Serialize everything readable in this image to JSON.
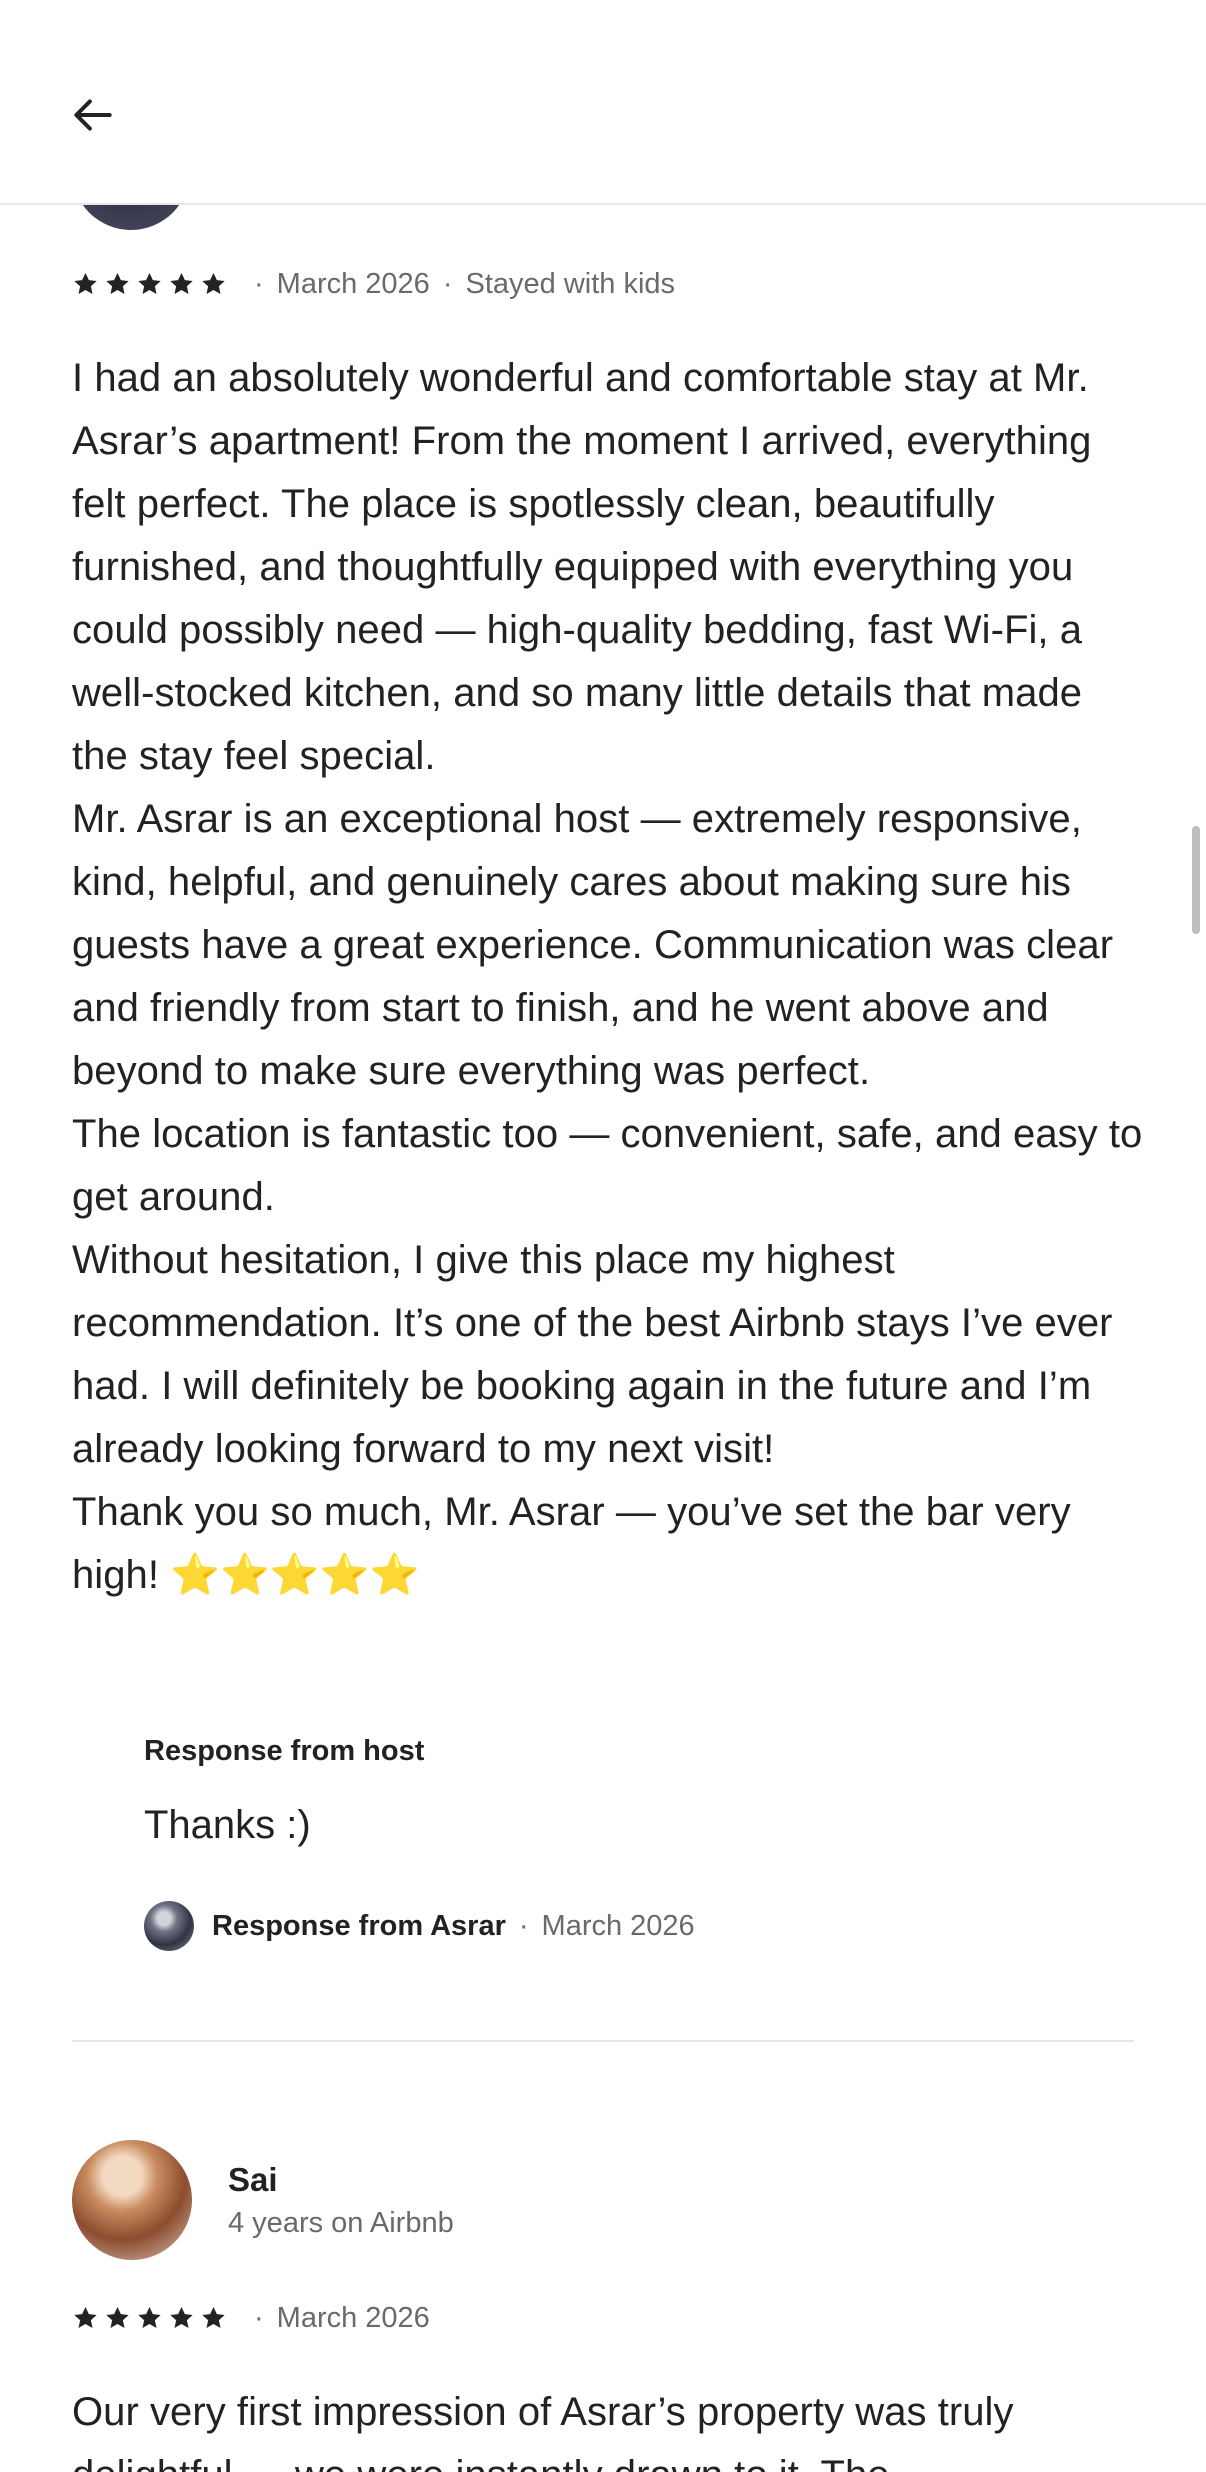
{
  "header": {
    "back_icon": "arrow-left-icon"
  },
  "review_1": {
    "stars": 5,
    "date": "March 2026",
    "trip_type": "Stayed with kids",
    "text": "I had an absolutely wonderful and comfortable stay at Mr. Asrar’s apartment! From the moment I arrived, everything felt perfect. The place is spotlessly clean, beautifully furnished, and thoughtfully equipped with everything you could possibly need — high-quality bedding, fast Wi-Fi, a well-stocked kitchen, and so many little details that made the stay feel special.\nMr. Asrar is an exceptional host — extremely responsive, kind, helpful, and genuinely cares about making sure his guests have a great experience. Communication was clear and friendly from start to finish, and he went above and beyond to make sure everything was perfect.\nThe location is fantastic too — convenient, safe, and easy to get around.\nWithout hesitation, I give this place my highest recommendation. It’s one of the best Airbnb stays I’ve ever had. I will definitely be booking again in the future and I’m already looking forward to my next visit!\nThank you so much, Mr. Asrar — you’ve set the bar very high! ⭐⭐⭐⭐⭐",
    "host_response": {
      "title": "Response from host",
      "text": "Thanks :)",
      "from": "Response from Asrar",
      "date": "March 2026"
    }
  },
  "review_2": {
    "reviewer_name": "Sai",
    "reviewer_sub": "4 years on Airbnb",
    "stars": 5,
    "date": "March 2026",
    "text": "Our very first impression of Asrar’s property was truly delightful — we were instantly drawn to it. The"
  },
  "colors": {
    "text": "#222222",
    "muted": "#6a6a6a",
    "divider": "#e6e6e6"
  }
}
